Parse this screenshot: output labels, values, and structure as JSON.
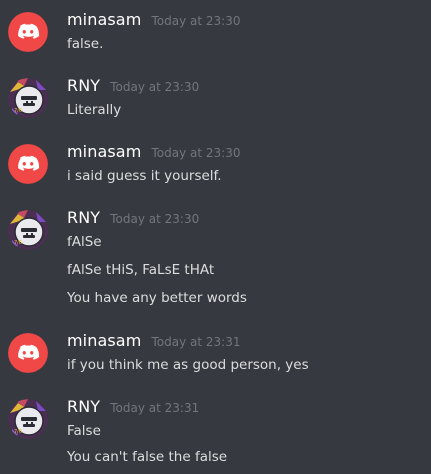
{
  "messages": [
    {
      "user": "minasam",
      "avatar": "discord-default-avatar-red",
      "time": "Today at 23:30",
      "lines": [
        "false."
      ]
    },
    {
      "user": "RNY",
      "avatar": "rny-avatar",
      "time": "Today at 23:30",
      "lines": [
        "Literally"
      ]
    },
    {
      "user": "minasam",
      "avatar": "discord-default-avatar-red",
      "time": "Today at 23:30",
      "lines": [
        "i said guess it yourself."
      ]
    },
    {
      "user": "RNY",
      "avatar": "rny-avatar",
      "time": "Today at 23:30",
      "lines": [
        "fAlSe",
        "fAlSe tHiS, FaLsE tHAt",
        "You have any better words"
      ]
    },
    {
      "user": "minasam",
      "avatar": "discord-default-avatar-red",
      "time": "Today at 23:31",
      "lines": [
        "if you think me as good person, yes"
      ]
    },
    {
      "user": "RNY",
      "avatar": "rny-avatar",
      "time": "Today at 23:31",
      "lines": [
        "False",
        "You can't false the false"
      ]
    }
  ],
  "colors": {
    "background": "#36393f",
    "username": "#ffffff",
    "timestamp": "#72767d",
    "message_text": "#dcddde",
    "discord_red": "#f04747"
  }
}
